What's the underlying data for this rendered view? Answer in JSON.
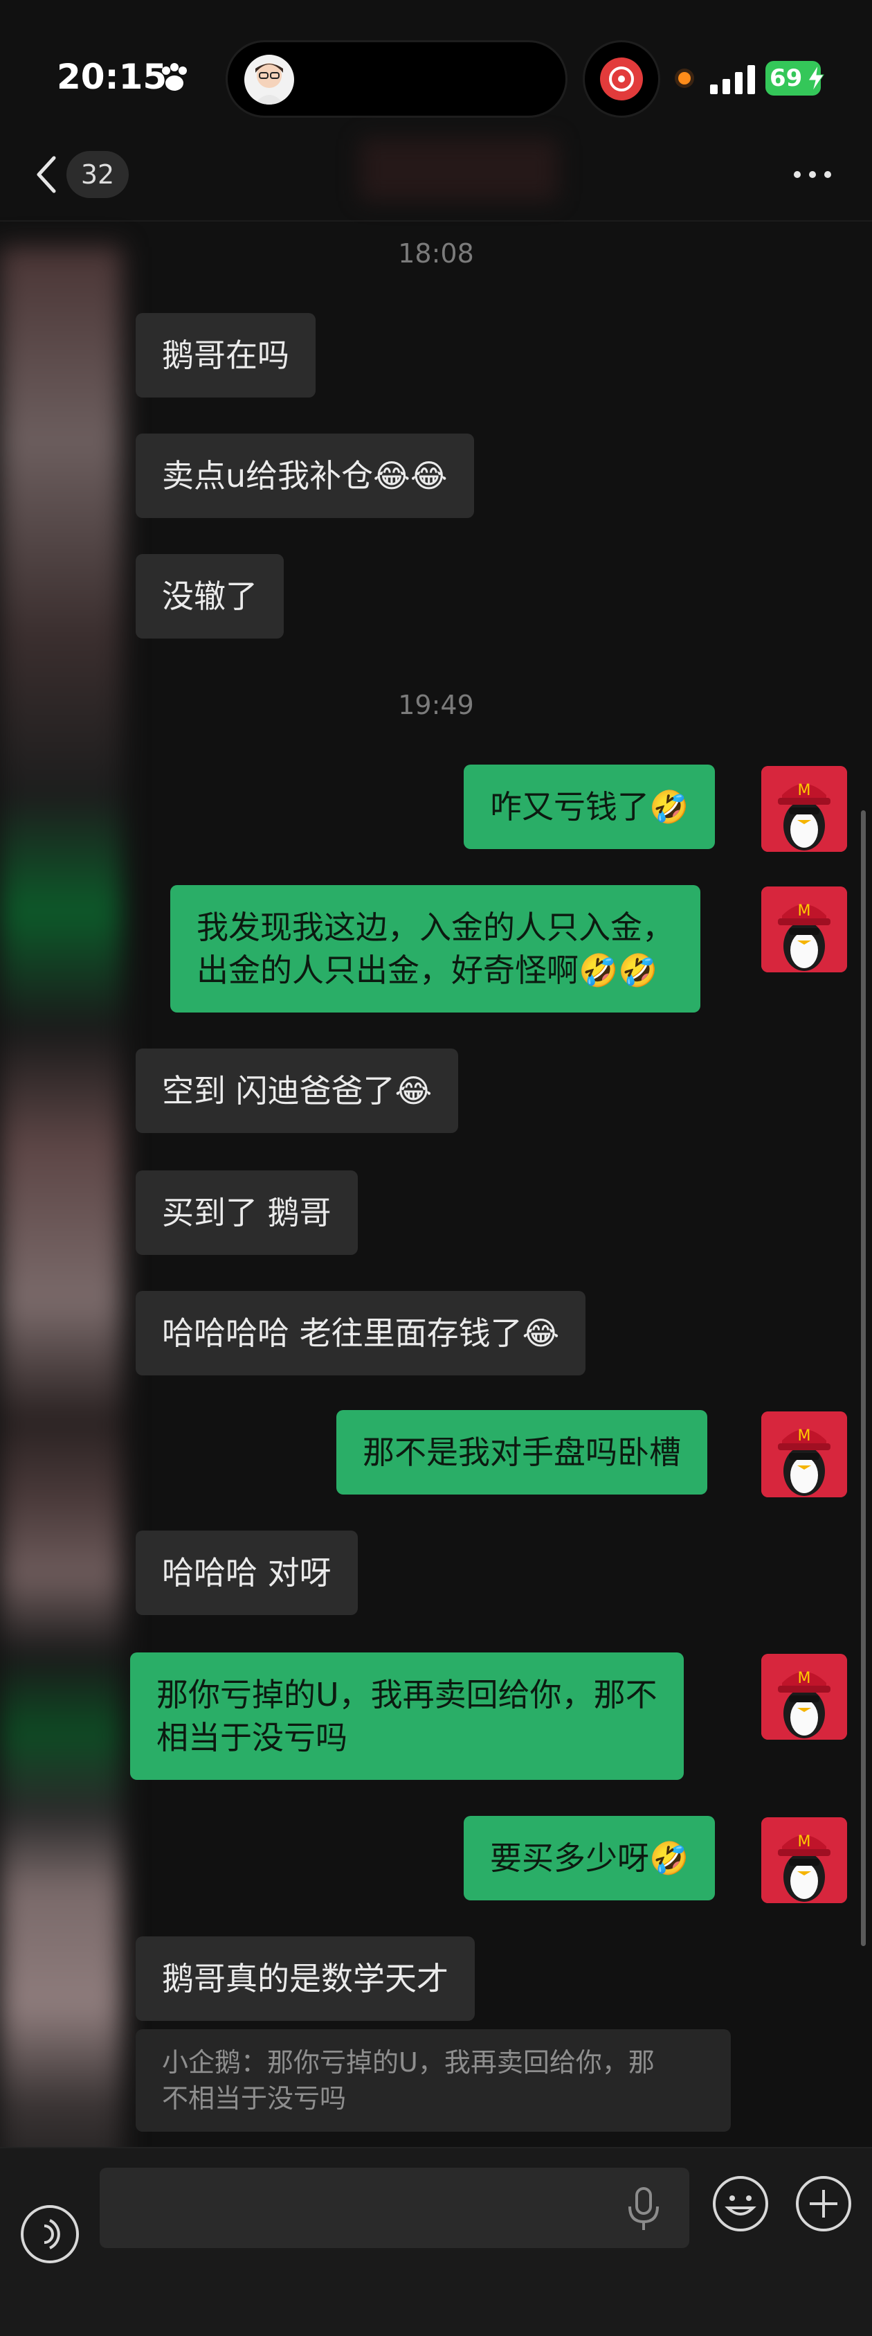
{
  "status": {
    "time": "20:15",
    "battery": "69"
  },
  "nav": {
    "unread_count": "32"
  },
  "chat": {
    "timestamp_1": "18:08",
    "timestamp_2": "19:49",
    "messages": [
      {
        "from": "other",
        "text": "鹅哥在吗"
      },
      {
        "from": "other",
        "text": "卖点u给我补仓😂😂"
      },
      {
        "from": "other",
        "text": "没辙了"
      },
      {
        "from": "me",
        "text": "咋又亏钱了🤣"
      },
      {
        "from": "me",
        "text": "我发现我这边，入金的人只入金，\n出金的人只出金，好奇怪啊🤣🤣"
      },
      {
        "from": "other",
        "text": "空到 闪迪爸爸了😂"
      },
      {
        "from": "other",
        "text": "买到了 鹅哥"
      },
      {
        "from": "other",
        "text": "哈哈哈哈 老往里面存钱了😂"
      },
      {
        "from": "me",
        "text": "那不是我对手盘吗卧槽"
      },
      {
        "from": "other",
        "text": "哈哈哈 对呀"
      },
      {
        "from": "me",
        "text": "那你亏掉的U，我再卖回给你，那不\n相当于没亏吗"
      },
      {
        "from": "me",
        "text": "要买多少呀🤣"
      },
      {
        "from": "other",
        "text": "鹅哥真的是数学天才"
      }
    ],
    "quote": "小企鹅：那你亏掉的U，我再卖回给你，那\n不相当于没亏吗"
  },
  "colors": {
    "background": "#111111",
    "incoming_bubble": "#2c2c2c",
    "outgoing_bubble": "#2aae67",
    "battery": "#34c759"
  },
  "icons": [
    "paw-icon",
    "back-icon",
    "more-icon",
    "signal-icon",
    "voice-icon",
    "mic-icon",
    "emoji-icon",
    "plus-icon"
  ]
}
